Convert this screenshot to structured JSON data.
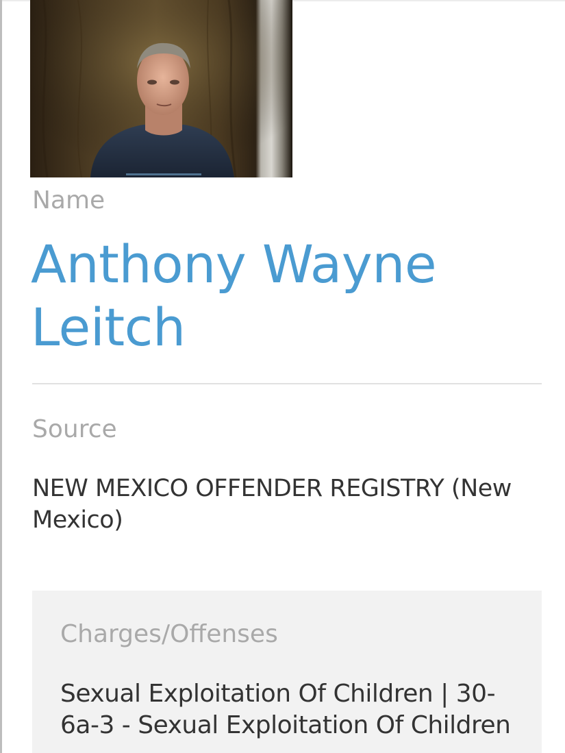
{
  "profile": {
    "photo_icon": "person-photo",
    "name_label": "Name",
    "name_value": "Anthony Wayne Leitch",
    "source_label": "Source",
    "source_value": "NEW MEXICO OFFENDER REGISTRY (New Mexico)",
    "charges_label": "Charges/Offenses",
    "charges_value": "Sexual Exploitation Of Children | 30-6a-3 - Sexual Exploitation Of Children"
  },
  "colors": {
    "name": "#4a9bd1",
    "label": "#a9a9a9",
    "body_text": "#333333",
    "panel": "#f2f2f2"
  }
}
